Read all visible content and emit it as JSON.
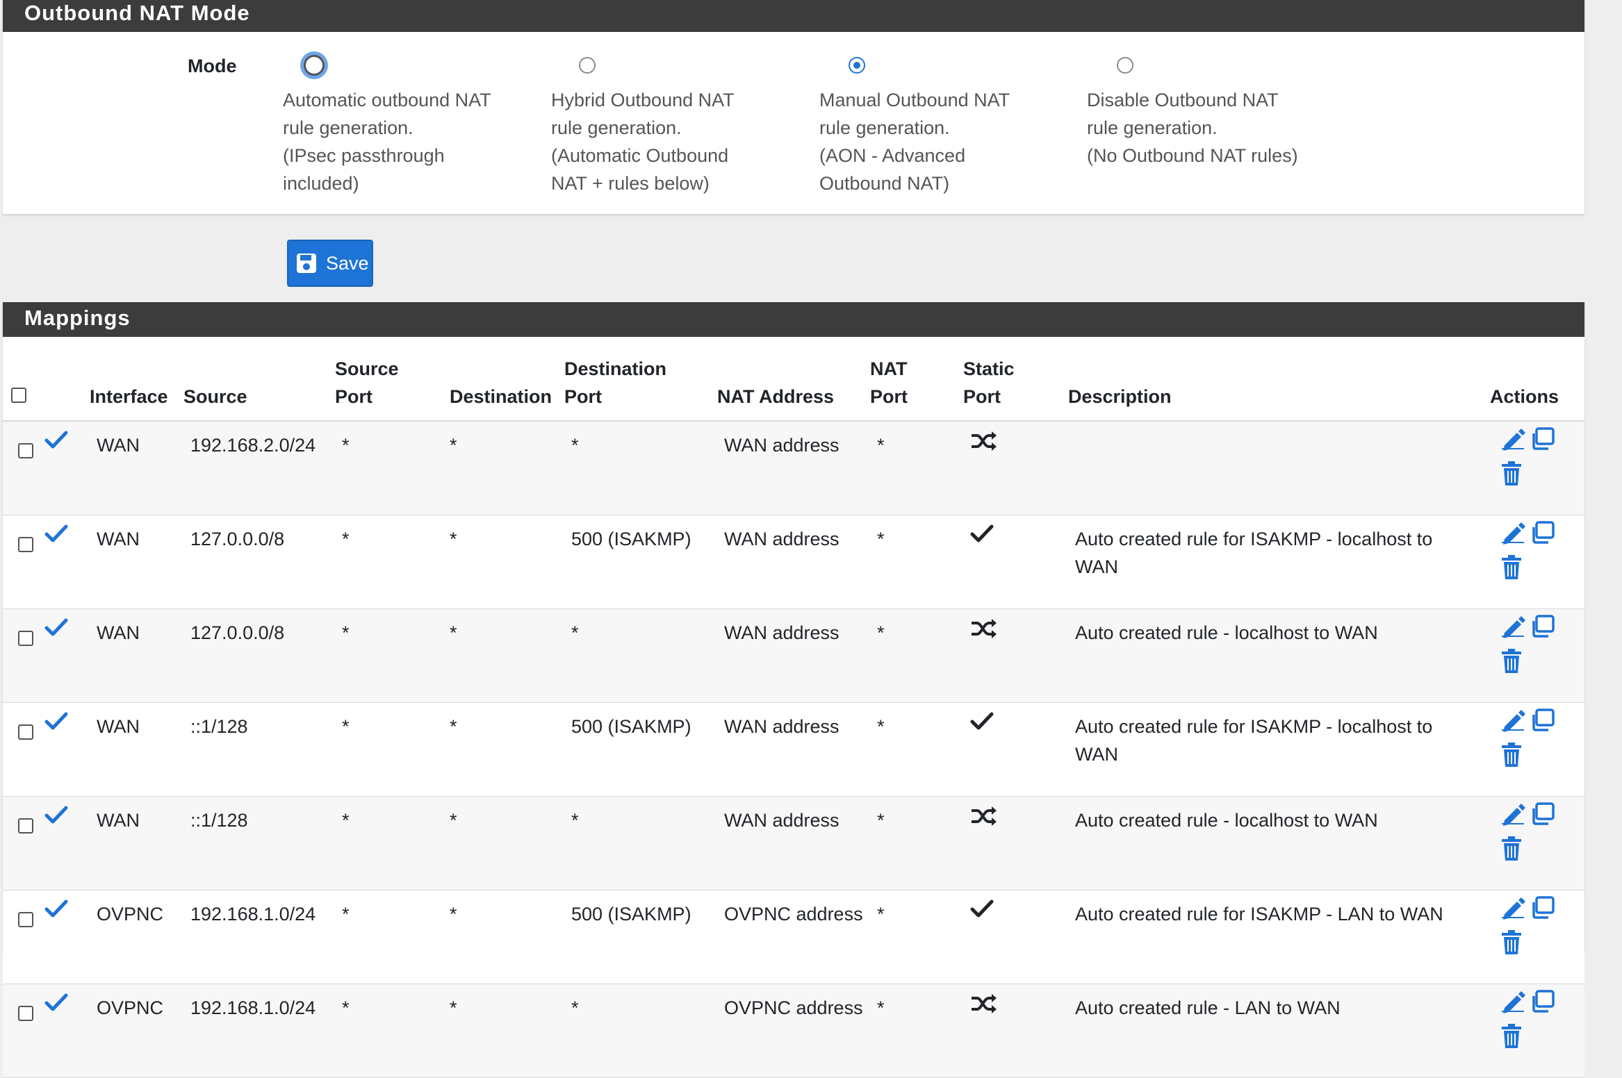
{
  "outbound_nat": {
    "title": "Outbound NAT Mode",
    "mode_label": "Mode",
    "options": [
      {
        "text": "Automatic outbound NAT\nrule generation.\n(IPsec passthrough\nincluded)",
        "checked": false,
        "focused": true
      },
      {
        "text": "Hybrid Outbound NAT\nrule generation.\n(Automatic Outbound\nNAT + rules below)",
        "checked": false,
        "focused": false
      },
      {
        "text": "Manual Outbound NAT\nrule generation.\n(AON - Advanced\nOutbound NAT)",
        "checked": true,
        "focused": false
      },
      {
        "text": "Disable Outbound NAT\nrule generation.\n(No Outbound NAT rules)",
        "checked": false,
        "focused": false
      }
    ]
  },
  "save_button": {
    "label": "Save",
    "icon": "floppy-disk-icon"
  },
  "mappings": {
    "title": "Mappings",
    "headers": {
      "interface": "Interface",
      "source": "Source",
      "source_port_1": "Source",
      "source_port_2": "Port",
      "destination": "Destination",
      "destination_port_1": "Destination",
      "destination_port_2": "Port",
      "nat_address": "NAT Address",
      "nat_port_1": "NAT",
      "nat_port_2": "Port",
      "static_port_1": "Static",
      "static_port_2": "Port",
      "description": "Description",
      "actions": "Actions"
    },
    "rows": [
      {
        "interface": "WAN",
        "source": "192.168.2.0/24",
        "source_port": "*",
        "destination": "*",
        "destination_port": "*",
        "nat_address": "WAN address",
        "nat_port": "*",
        "static_port": "shuffle-icon",
        "description": ""
      },
      {
        "interface": "WAN",
        "source": "127.0.0.0/8",
        "source_port": "*",
        "destination": "*",
        "destination_port": "500 (ISAKMP)",
        "nat_address": "WAN address",
        "nat_port": "*",
        "static_port": "check-icon",
        "description": "Auto created rule for ISAKMP - localhost to WAN"
      },
      {
        "interface": "WAN",
        "source": "127.0.0.0/8",
        "source_port": "*",
        "destination": "*",
        "destination_port": "*",
        "nat_address": "WAN address",
        "nat_port": "*",
        "static_port": "shuffle-icon",
        "description": "Auto created rule - localhost to WAN"
      },
      {
        "interface": "WAN",
        "source": "::1/128",
        "source_port": "*",
        "destination": "*",
        "destination_port": "500 (ISAKMP)",
        "nat_address": "WAN address",
        "nat_port": "*",
        "static_port": "check-icon",
        "description": "Auto created rule for ISAKMP - localhost to WAN"
      },
      {
        "interface": "WAN",
        "source": "::1/128",
        "source_port": "*",
        "destination": "*",
        "destination_port": "*",
        "nat_address": "WAN address",
        "nat_port": "*",
        "static_port": "shuffle-icon",
        "description": "Auto created rule - localhost to WAN"
      },
      {
        "interface": "OVPNC",
        "source": "192.168.1.0/24",
        "source_port": "*",
        "destination": "*",
        "destination_port": "500 (ISAKMP)",
        "nat_address": "OVPNC address",
        "nat_port": "*",
        "static_port": "check-icon",
        "description": "Auto created rule for ISAKMP - LAN to WAN"
      },
      {
        "interface": "OVPNC",
        "source": "192.168.1.0/24",
        "source_port": "*",
        "destination": "*",
        "destination_port": "*",
        "nat_address": "OVPNC address",
        "nat_port": "*",
        "static_port": "shuffle-icon",
        "description": "Auto created rule - LAN to WAN"
      }
    ]
  },
  "colors": {
    "accent": "#1e73d6",
    "heading_bg": "#3c3c3c"
  }
}
